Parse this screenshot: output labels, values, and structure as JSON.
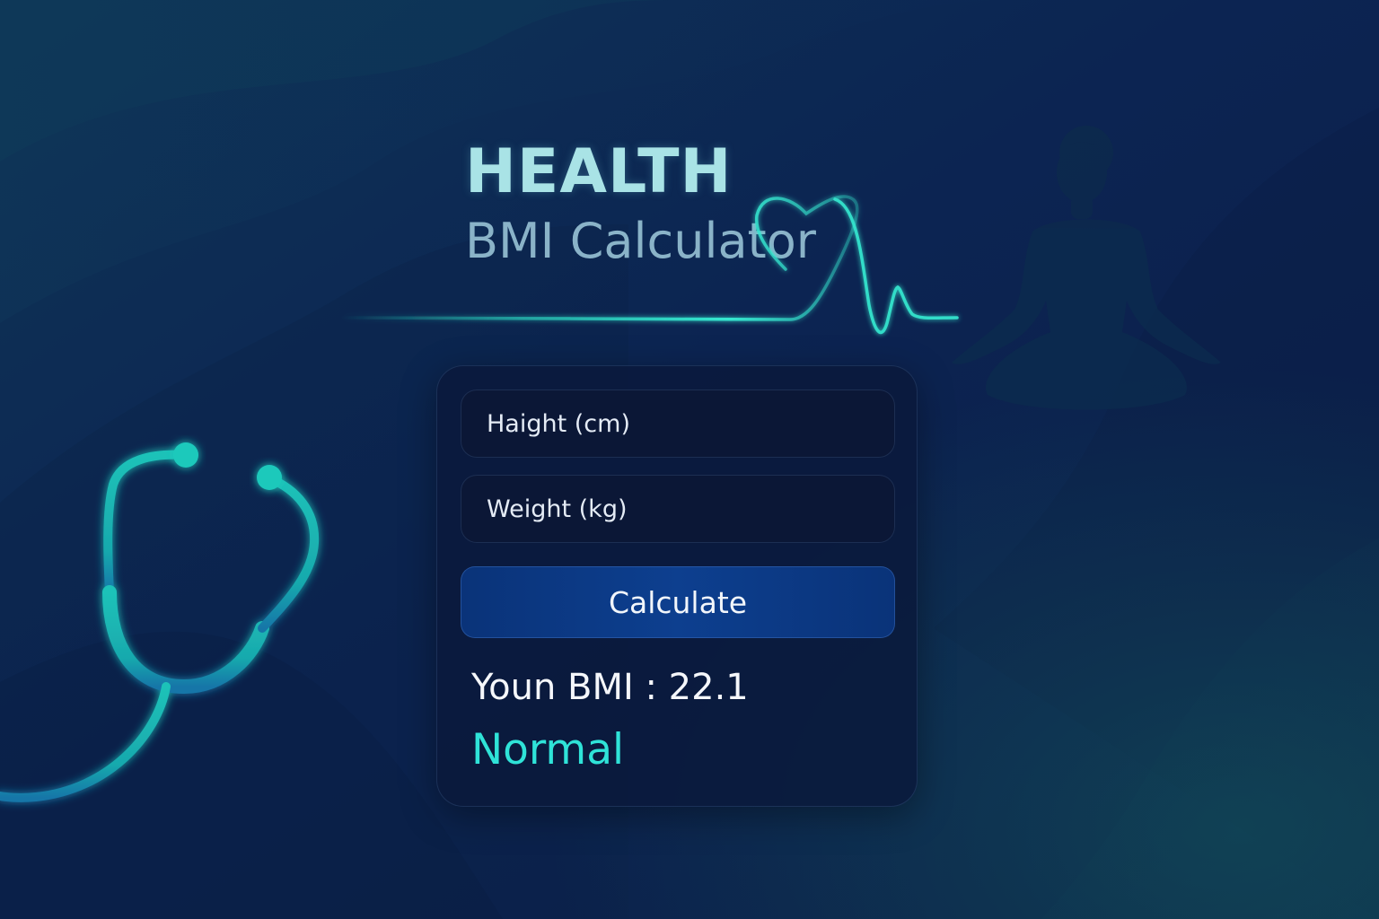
{
  "header": {
    "title": "HEALTH",
    "subtitle": "BMI Calculator"
  },
  "form": {
    "height_placeholder": "Haight (cm)",
    "weight_placeholder": "Weight (kg)",
    "calculate_label": "Calculate"
  },
  "result": {
    "label": "Youn BMI : ",
    "value": "22.1",
    "category": "Normal"
  },
  "decor": {
    "icons": [
      "stethoscope-icon",
      "heart-pulse-icon",
      "meditation-silhouette-icon"
    ],
    "accent_color": "#2fe3d8",
    "background_color": "#0c2350"
  }
}
